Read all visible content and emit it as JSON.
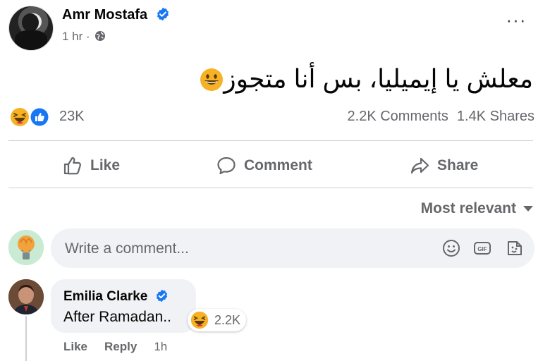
{
  "post": {
    "author": "Amr Mostafa",
    "time": "1 hr",
    "text": "معلش يا إيميليا، بس أنا متجوز",
    "reaction_count": "23K",
    "comments_count": "2.2K Comments",
    "shares_count": "1.4K Shares"
  },
  "actions": {
    "like": "Like",
    "comment": "Comment",
    "share": "Share"
  },
  "sort_label": "Most relevant",
  "comment_input": {
    "placeholder": "Write a comment..."
  },
  "comment": {
    "author": "Emilia Clarke",
    "text": "After Ramadan..",
    "reaction_count": "2.2K",
    "like": "Like",
    "reply": "Reply",
    "time": "1h"
  },
  "colors": {
    "accent": "#1877f2",
    "haha": "#f7b125",
    "text_secondary": "#65676b"
  },
  "icons": [
    "verified-badge-icon",
    "globe-icon",
    "more-options-icon",
    "haha-emoji-icon",
    "like-reaction-icon",
    "like-thumb-icon",
    "comment-bubble-icon",
    "share-arrow-icon",
    "caret-down-icon",
    "emoji-smiley-icon",
    "gif-icon",
    "sticker-icon"
  ]
}
